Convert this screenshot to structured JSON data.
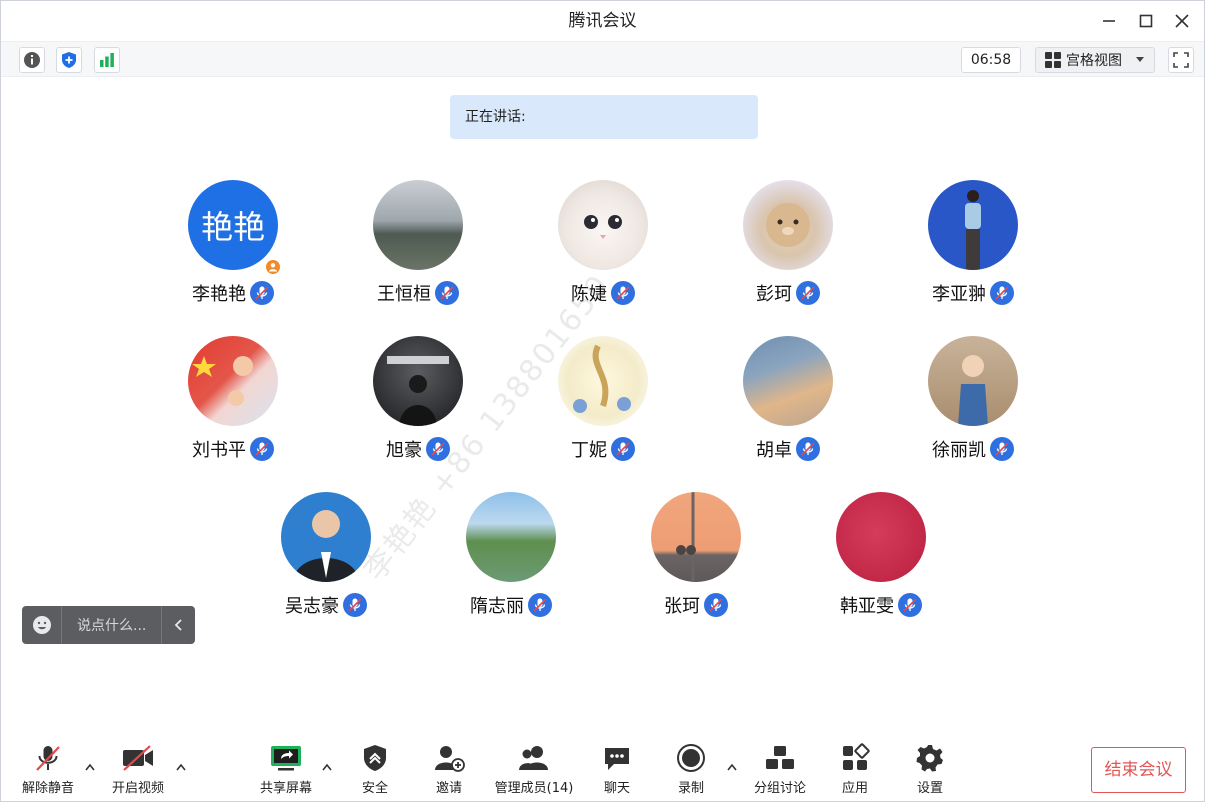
{
  "window": {
    "title": "腾讯会议"
  },
  "toolbar": {
    "timer": "06:58",
    "view_label": "宫格视图"
  },
  "speaking": {
    "label": "正在讲话:"
  },
  "participants": [
    {
      "name": "李艳艳",
      "avatar_text": "艳艳",
      "host": true
    },
    {
      "name": "王恒桓"
    },
    {
      "name": "陈婕"
    },
    {
      "name": "彭珂"
    },
    {
      "name": "李亚翀"
    },
    {
      "name": "刘书平"
    },
    {
      "name": "旭豪"
    },
    {
      "name": "丁妮"
    },
    {
      "name": "胡卓"
    },
    {
      "name": "徐丽凯"
    },
    {
      "name": "吴志豪"
    },
    {
      "name": "隋志丽"
    },
    {
      "name": "张珂"
    },
    {
      "name": "韩亚雯"
    }
  ],
  "chat": {
    "placeholder": "说点什么..."
  },
  "bottom": {
    "unmute": "解除静音",
    "video": "开启视频",
    "share": "共享屏幕",
    "security": "安全",
    "invite": "邀请",
    "members": "管理成员(14)",
    "chat": "聊天",
    "record": "录制",
    "breakout": "分组讨论",
    "apps": "应用",
    "settings": "设置",
    "end": "结束会议"
  },
  "watermark": "李艳艳 +86 138801650"
}
